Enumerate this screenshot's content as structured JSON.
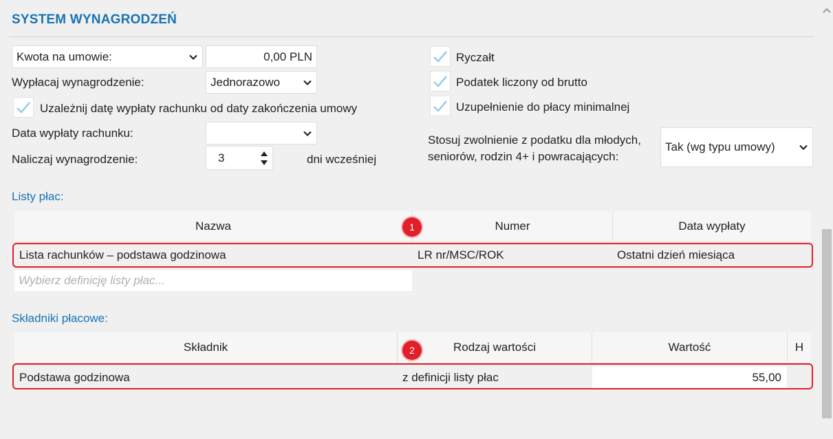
{
  "header": {
    "title": "SYSTEM WYNAGRODZEŃ"
  },
  "form": {
    "amount_type": "Kwota na umowie:",
    "amount_value": "0,00 PLN",
    "pay_label": "Wypłacaj wynagrodzenie:",
    "pay_value": "Jednorazowo",
    "depend_label": "Uzależnij datę wypłaty rachunku od daty zakończenia umowy",
    "pay_date_label": "Data wypłaty rachunku:",
    "pay_date_value": "",
    "accrue_label": "Naliczaj wynagrodzenie:",
    "accrue_value": "3",
    "accrue_suffix": "dni wcześniej",
    "lump_sum_label": "Ryczałt",
    "gross_tax_label": "Podatek liczony od brutto",
    "min_wage_label": "Uzupełnienie do płacy minimalnej",
    "exemption_label_1": "Stosuj zwolnienie z podatku dla młodych,",
    "exemption_label_2": "seniorów, rodzin 4+ i powracających:",
    "exemption_value": "Tak (wg typu umowy)"
  },
  "payroll_lists": {
    "section_title": "Listy płac:",
    "headers": [
      "Nazwa",
      "Numer",
      "Data wypłaty"
    ],
    "rows": [
      {
        "name": "Lista rachunków – podstawa godzinowa",
        "number": "LR nr/MSC/ROK",
        "date": "Ostatni dzień miesiąca"
      }
    ],
    "placeholder": "Wybierz definicję listy płac...",
    "badge": "1"
  },
  "components": {
    "section_title": "Składniki płacowe:",
    "headers": [
      "Składnik",
      "Rodzaj wartości",
      "Wartość",
      "H"
    ],
    "rows": [
      {
        "component": "Podstawa godzinowa",
        "value_type": "z definicji listy płac",
        "value": "55,00",
        "h": ""
      }
    ],
    "badge": "2"
  },
  "colors": {
    "accent": "#1a73b2",
    "highlight": "#e21e2a",
    "check": "#9ecbe6"
  },
  "icons": [
    "chevron-down-icon",
    "checkmark-icon",
    "spin-up-icon",
    "spin-down-icon",
    "scroll-up-icon"
  ]
}
